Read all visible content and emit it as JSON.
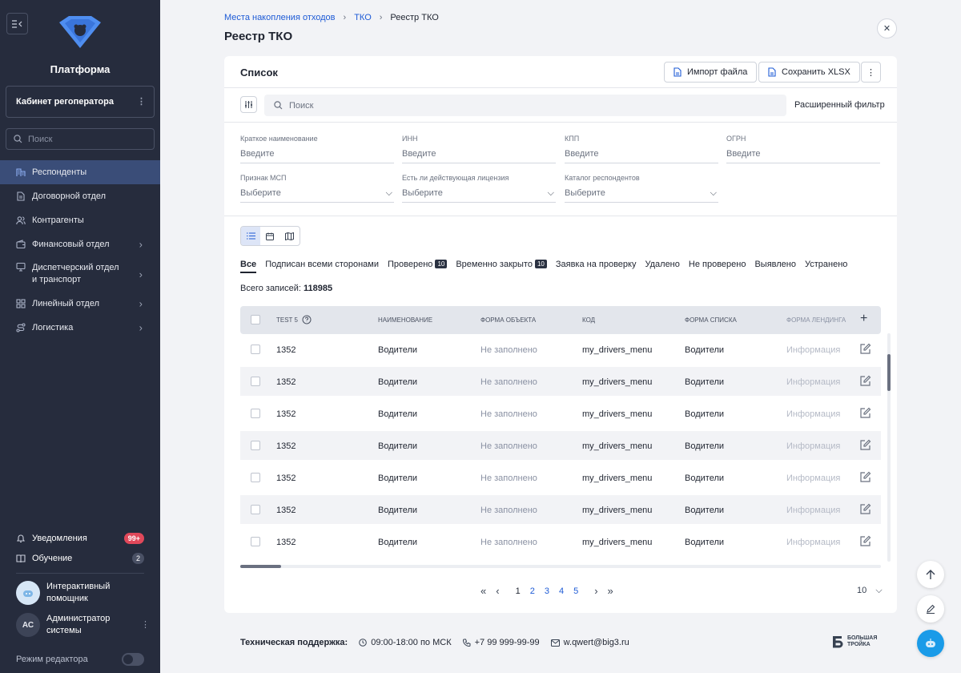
{
  "sidebar": {
    "platform_title": "Платформа",
    "cabinet_label": "Кабинет регоператора",
    "search_placeholder": "Поиск",
    "items": [
      {
        "label": "Респонденты"
      },
      {
        "label": "Договорной отдел"
      },
      {
        "label": "Контрагенты"
      },
      {
        "label": "Финансовый отдел"
      },
      {
        "label": "Диспетчерский отдел и транспорт"
      },
      {
        "label": "Линейный отдел"
      },
      {
        "label": "Логистика"
      }
    ],
    "notifications": {
      "label": "Уведомления",
      "badge": "99+"
    },
    "training": {
      "label": "Обучение",
      "badge": "2"
    },
    "assistant": {
      "label": "Интерактивный помощник"
    },
    "user": {
      "initials": "АС",
      "name": "Администратор системы"
    },
    "editor_mode_label": "Режим редактора"
  },
  "breadcrumb": [
    "Места накопления отходов",
    "ТКО",
    "Реестр ТКО"
  ],
  "page_title": "Реестр ТКО",
  "card": {
    "title": "Список",
    "import_label": "Импорт файла",
    "save_label": "Сохранить XLSX",
    "search_placeholder": "Поиск",
    "advanced_filter": "Расширенный фильтр"
  },
  "filters": [
    {
      "label": "Краткое наименование",
      "value": "Введите"
    },
    {
      "label": "ИНН",
      "value": "Введите"
    },
    {
      "label": "КПП",
      "value": "Введите"
    },
    {
      "label": "ОГРН",
      "value": "Введите"
    },
    {
      "label": "Признак МСП",
      "value": "Выберите"
    },
    {
      "label": "Есть ли действующая лицензия",
      "value": "Выберите"
    },
    {
      "label": "Каталог респондентов",
      "value": "Выберите"
    }
  ],
  "tabs": [
    {
      "label": "Все",
      "count": ""
    },
    {
      "label": "Подписан всеми сторонами",
      "count": ""
    },
    {
      "label": "Проверено",
      "count": "10"
    },
    {
      "label": "Временно закрыто",
      "count": "10"
    },
    {
      "label": "Заявка на проверку",
      "count": ""
    },
    {
      "label": "Удалено",
      "count": ""
    },
    {
      "label": "Не проверено",
      "count": ""
    },
    {
      "label": "Выявлено",
      "count": ""
    },
    {
      "label": "Устранено",
      "count": ""
    }
  ],
  "total": {
    "label": "Всего записей:",
    "value": "118985"
  },
  "table": {
    "columns": [
      "TEST 5",
      "Наименование",
      "Форма объекта",
      "Код",
      "Форма списка",
      "Форма лендинга"
    ],
    "rows": [
      [
        "1352",
        "Водители",
        "Не заполнено",
        "my_drivers_menu",
        "Водители",
        "Информация"
      ],
      [
        "1352",
        "Водители",
        "Не заполнено",
        "my_drivers_menu",
        "Водители",
        "Информация"
      ],
      [
        "1352",
        "Водители",
        "Не заполнено",
        "my_drivers_menu",
        "Водители",
        "Информация"
      ],
      [
        "1352",
        "Водители",
        "Не заполнено",
        "my_drivers_menu",
        "Водители",
        "Информация"
      ],
      [
        "1352",
        "Водители",
        "Не заполнено",
        "my_drivers_menu",
        "Водители",
        "Информация"
      ],
      [
        "1352",
        "Водители",
        "Не заполнено",
        "my_drivers_menu",
        "Водители",
        "Информация"
      ],
      [
        "1352",
        "Водители",
        "Не заполнено",
        "my_drivers_menu",
        "Водители",
        "Информация"
      ]
    ]
  },
  "pagination": {
    "pages": [
      "1",
      "2",
      "3",
      "4",
      "5"
    ],
    "current": "1",
    "per_page": "10"
  },
  "footer": {
    "label": "Техническая поддержка:",
    "hours": "09:00-18:00 по МСК",
    "phone": "+7 99 999-99-99",
    "email": "w.qwert@big3.ru",
    "brand_line1": "БОЛЬШАЯ",
    "brand_line2": "ТРОЙКА"
  },
  "colors": {
    "sidebar_bg": "#262c3d",
    "active_item": "#3a4d78",
    "link": "#1e5bd6",
    "badge_red": "#e0485a",
    "fab_blue": "#1a9be8"
  }
}
